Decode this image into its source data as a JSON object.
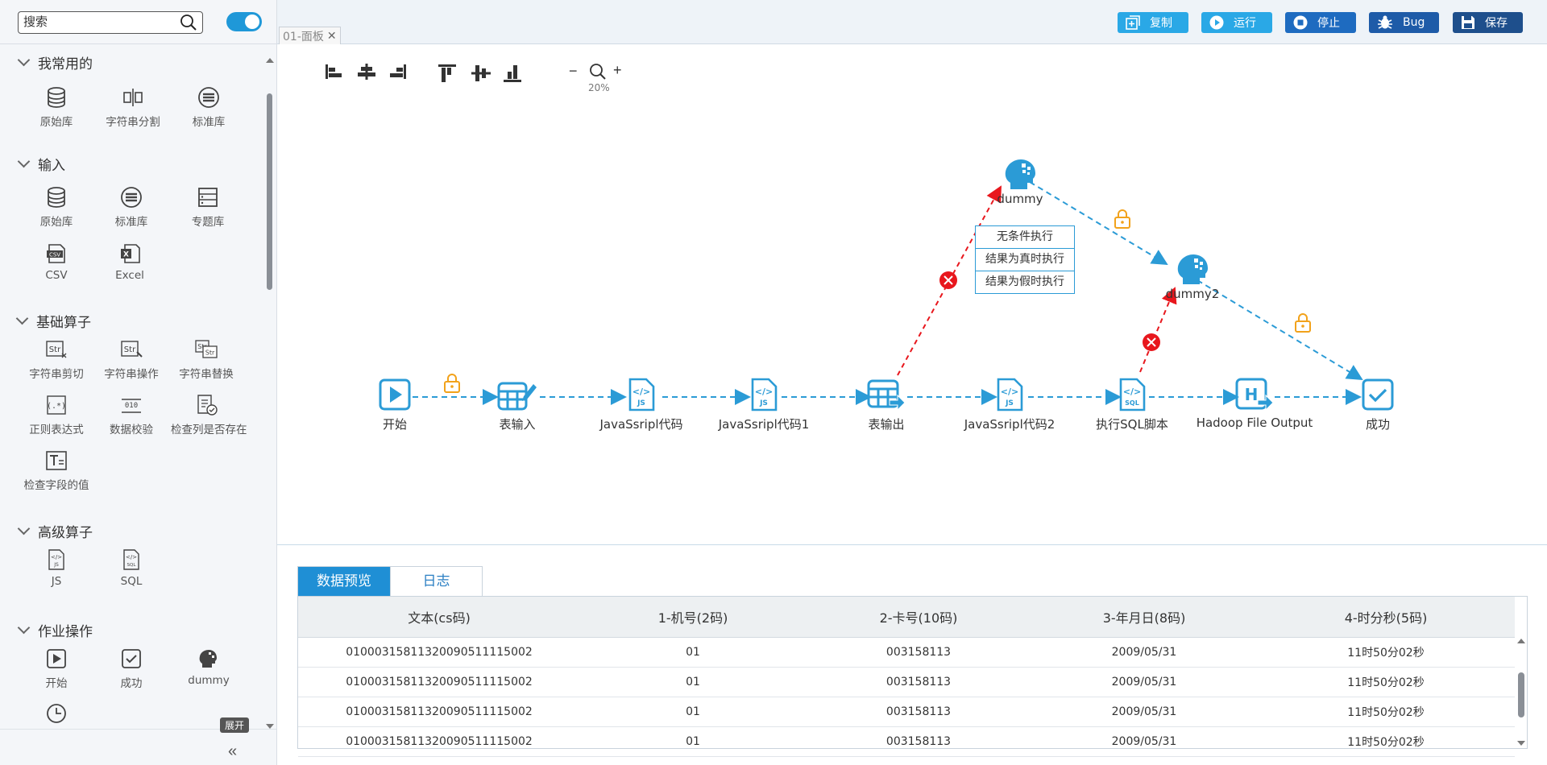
{
  "sidebar": {
    "search_placeholder": "搜索",
    "sections": [
      {
        "title": "我常用的",
        "items": [
          {
            "label": "原始库",
            "icon": "database-icon"
          },
          {
            "label": "字符串分割",
            "icon": "string-split-icon"
          },
          {
            "label": "标准库",
            "icon": "standard-library-icon"
          }
        ]
      },
      {
        "title": "输入",
        "items": [
          {
            "label": "原始库",
            "icon": "database-icon"
          },
          {
            "label": "标准库",
            "icon": "standard-library-icon"
          },
          {
            "label": "专题库",
            "icon": "topic-library-icon"
          },
          {
            "label": "CSV",
            "icon": "csv-icon"
          },
          {
            "label": "Excel",
            "icon": "excel-icon"
          }
        ]
      },
      {
        "title": "基础算子",
        "items": [
          {
            "label": "字符串剪切",
            "icon": "string-cut-icon"
          },
          {
            "label": "字符串操作",
            "icon": "string-operate-icon"
          },
          {
            "label": "字符串替换",
            "icon": "string-replace-icon"
          },
          {
            "label": "正则表达式",
            "icon": "regex-icon"
          },
          {
            "label": "数据校验",
            "icon": "data-check-icon"
          },
          {
            "label": "检查列是否存在",
            "icon": "column-check-icon"
          },
          {
            "label": "检查字段的值",
            "icon": "field-value-check-icon"
          }
        ]
      },
      {
        "title": "高级算子",
        "items": [
          {
            "label": "JS",
            "icon": "js-file-icon"
          },
          {
            "label": "SQL",
            "icon": "sql-file-icon"
          }
        ]
      },
      {
        "title": "作业操作",
        "items": [
          {
            "label": "开始",
            "icon": "play-icon"
          },
          {
            "label": "成功",
            "icon": "check-icon"
          },
          {
            "label": "dummy",
            "icon": "dummy-head-icon"
          },
          {
            "label": "",
            "icon": "clock-icon"
          }
        ]
      }
    ],
    "expand_tooltip": "展开"
  },
  "tab": {
    "label": "01-面板"
  },
  "toolbar": {
    "buttons": [
      {
        "label": "复制",
        "icon": "copy-icon",
        "color": "#2aa8e6"
      },
      {
        "label": "运行",
        "icon": "run-icon",
        "color": "#2aa8e6"
      },
      {
        "label": "停止",
        "icon": "stop-icon",
        "color": "#1e6bc0"
      },
      {
        "label": "Bug",
        "icon": "bug-icon",
        "color": "#1e5ba8"
      },
      {
        "label": "保存",
        "icon": "save-icon",
        "color": "#1e4f8c"
      }
    ]
  },
  "canvas": {
    "zoom_level": "20%",
    "nodes": [
      {
        "label": "开始",
        "icon": "play-icon"
      },
      {
        "label": "表输入",
        "icon": "table-input-icon"
      },
      {
        "label": "JavaSsripl代码",
        "icon": "js-file-icon"
      },
      {
        "label": "JavaSsripl代码1",
        "icon": "js-file-icon"
      },
      {
        "label": "表输出",
        "icon": "table-output-icon"
      },
      {
        "label": "JavaSsripl代码2",
        "icon": "js-file-icon"
      },
      {
        "label": "执行SQL脚本",
        "icon": "sql-file-icon"
      },
      {
        "label": "Hadoop File Output",
        "icon": "hadoop-output-icon"
      },
      {
        "label": "成功",
        "icon": "check-icon"
      },
      {
        "label": "dummy",
        "icon": "dummy-head-icon"
      },
      {
        "label": "dummy2",
        "icon": "dummy-head-icon"
      }
    ],
    "condition_menu": [
      "无条件执行",
      "结果为真时执行",
      "结果为假时执行"
    ]
  },
  "bottom": {
    "tabs": [
      {
        "label": "数据预览",
        "active": true
      },
      {
        "label": "日志",
        "active": false
      }
    ],
    "table": {
      "columns": [
        "文本(cs码)",
        "1-机号(2码)",
        "2-卡号(10码)",
        "3-年月日(8码)",
        "4-时分秒(5码)"
      ],
      "rows": [
        [
          "01000315811320090511115002",
          "01",
          "003158113",
          "2009/05/31",
          "11时50分02秒"
        ],
        [
          "01000315811320090511115002",
          "01",
          "003158113",
          "2009/05/31",
          "11时50分02秒"
        ],
        [
          "01000315811320090511115002",
          "01",
          "003158113",
          "2009/05/31",
          "11时50分02秒"
        ],
        [
          "01000315811320090511115002",
          "01",
          "003158113",
          "2009/05/31",
          "11时50分02秒"
        ]
      ]
    }
  }
}
